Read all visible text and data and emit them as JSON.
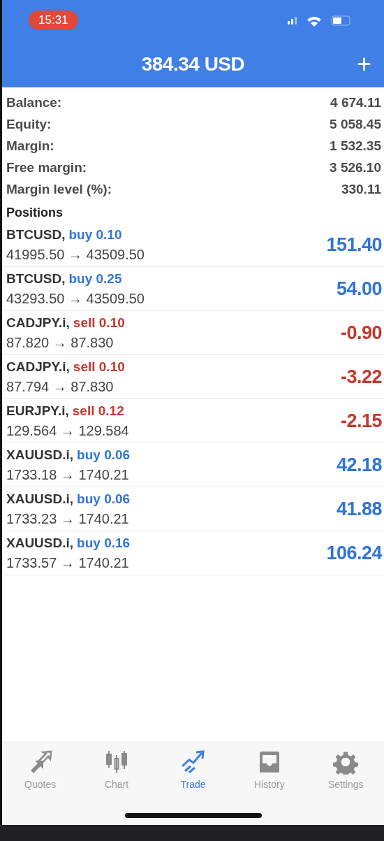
{
  "status_bar": {
    "time": "15:31"
  },
  "header": {
    "title": "384.34 USD",
    "action": "+"
  },
  "summary": [
    {
      "label": "Balance:",
      "value": "4 674.11"
    },
    {
      "label": "Equity:",
      "value": "5 058.45"
    },
    {
      "label": "Margin:",
      "value": "1 532.35"
    },
    {
      "label": "Free margin:",
      "value": "3 526.10"
    },
    {
      "label": "Margin level (%):",
      "value": "330.11"
    }
  ],
  "positions_title": "Positions",
  "positions": [
    {
      "symbol": "BTCUSD,",
      "order": "buy 0.10",
      "kind": "buy",
      "prices": "41995.50 → 43509.50",
      "profit": "151.40"
    },
    {
      "symbol": "BTCUSD,",
      "order": "buy 0.25",
      "kind": "buy",
      "prices": "43293.50 → 43509.50",
      "profit": "54.00"
    },
    {
      "symbol": "CADJPY.i,",
      "order": "sell 0.10",
      "kind": "sell",
      "prices": "87.820 → 87.830",
      "profit": "-0.90"
    },
    {
      "symbol": "CADJPY.i,",
      "order": "sell 0.10",
      "kind": "sell",
      "prices": "87.794 → 87.830",
      "profit": "-3.22"
    },
    {
      "symbol": "EURJPY.i,",
      "order": "sell 0.12",
      "kind": "sell",
      "prices": "129.564 → 129.584",
      "profit": "-2.15"
    },
    {
      "symbol": "XAUUSD.i,",
      "order": "buy 0.06",
      "kind": "buy",
      "prices": "1733.18 → 1740.21",
      "profit": "42.18"
    },
    {
      "symbol": "XAUUSD.i,",
      "order": "buy 0.06",
      "kind": "buy",
      "prices": "1733.23 → 1740.21",
      "profit": "41.88"
    },
    {
      "symbol": "XAUUSD.i,",
      "order": "buy 0.16",
      "kind": "buy",
      "prices": "1733.57 → 1740.21",
      "profit": "106.24"
    }
  ],
  "tabs": [
    {
      "label": "Quotes",
      "selected": false
    },
    {
      "label": "Chart",
      "selected": false
    },
    {
      "label": "Trade",
      "selected": true
    },
    {
      "label": "History",
      "selected": false
    },
    {
      "label": "Settings",
      "selected": false
    }
  ]
}
